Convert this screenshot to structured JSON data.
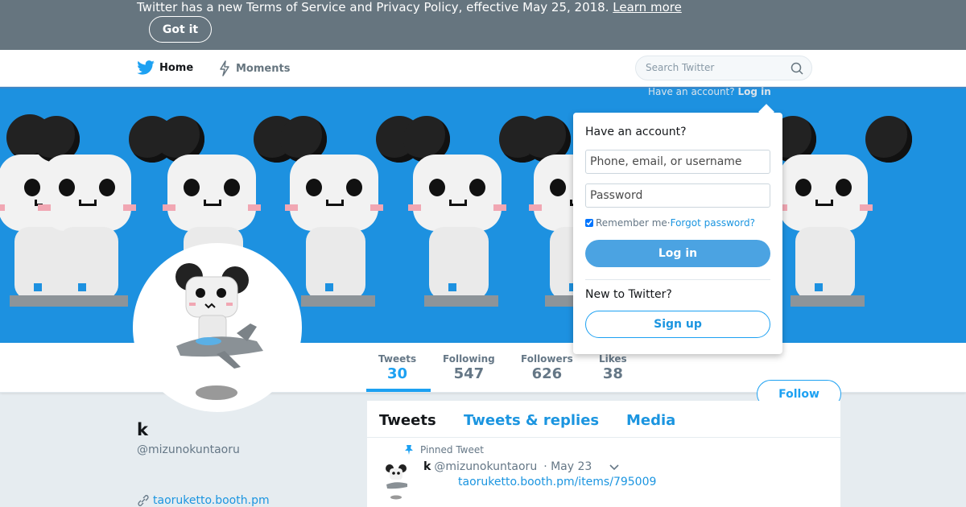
{
  "banner": {
    "text": "Twitter has a new Terms of Service and Privacy Policy, effective May 25, 2018.",
    "link": "Learn more",
    "button": "Got it"
  },
  "nav": {
    "home": "Home",
    "moments": "Moments",
    "search_placeholder": "Search Twitter"
  },
  "login_trigger": {
    "question": "Have an account?",
    "action": "Log in"
  },
  "stats": [
    {
      "label": "Tweets",
      "value": "30"
    },
    {
      "label": "Following",
      "value": "547"
    },
    {
      "label": "Followers",
      "value": "626"
    },
    {
      "label": "Likes",
      "value": "38"
    }
  ],
  "follow_button": "Follow",
  "profile": {
    "name": "k",
    "handle": "@mizunokuntaoru",
    "website": "taoruketto.booth.pm"
  },
  "tabs": [
    "Tweets",
    "Tweets & replies",
    "Media"
  ],
  "pinned_tweet": {
    "label": "Pinned Tweet",
    "name": "k",
    "handle": "@mizunokuntaoru",
    "date": "· May 23",
    "text": "taoruketto.booth.pm/items/795009"
  },
  "login_dropdown": {
    "title": "Have an account?",
    "username_placeholder": "Phone, email, or username",
    "password_placeholder": "Password",
    "remember": "Remember me",
    "separator": " · ",
    "forgot": "Forgot password?",
    "login_button": "Log in",
    "new_text": "New to Twitter?",
    "signup_button": "Sign up"
  },
  "colors": {
    "banner": "#66757f",
    "header_bg": "#1d91e0",
    "accent": "#1da1f2",
    "login_button": "#4ba3e2"
  },
  "icons": [
    "twitter-bird-icon",
    "lightning-icon",
    "search-icon",
    "pin-icon",
    "link-icon",
    "chevron-down-icon"
  ]
}
